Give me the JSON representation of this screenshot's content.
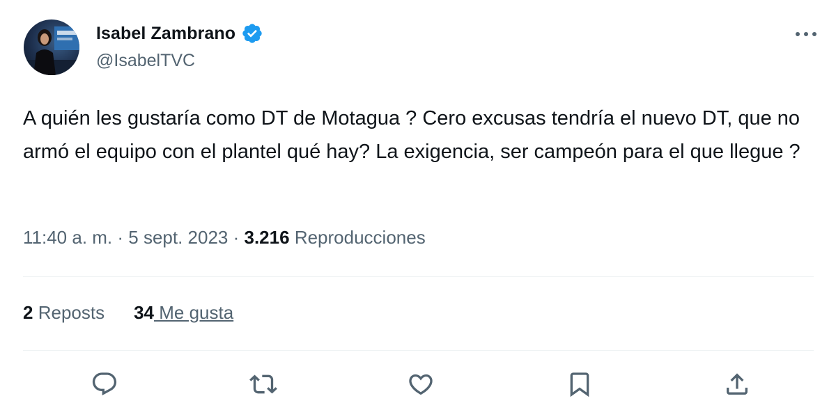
{
  "author": {
    "name": "Isabel Zambrano",
    "handle": "@IsabelTVC",
    "verified_color": "#1d9bf0"
  },
  "tweet": {
    "text": "A quién les gustaría como DT de Motagua ? Cero excusas tendría el nuevo DT, que no armó el equipo con el plantel qué hay? La exigencia, ser campeón para el que llegue ?"
  },
  "meta": {
    "time": "11:40 a. m.",
    "separator": " · ",
    "date": "5 sept. 2023",
    "views_count": "3.216",
    "views_label": "Reproducciones"
  },
  "stats": {
    "reposts_count": "2",
    "reposts_label": "Reposts",
    "likes_count": "34",
    "likes_label": " Me gusta"
  },
  "actions": [
    "reply-icon",
    "repost-icon",
    "like-icon",
    "bookmark-icon",
    "share-icon"
  ],
  "colors": {
    "text": "#0f1419",
    "secondary": "#536471",
    "divider": "#eff3f4",
    "icon": "#536471"
  }
}
